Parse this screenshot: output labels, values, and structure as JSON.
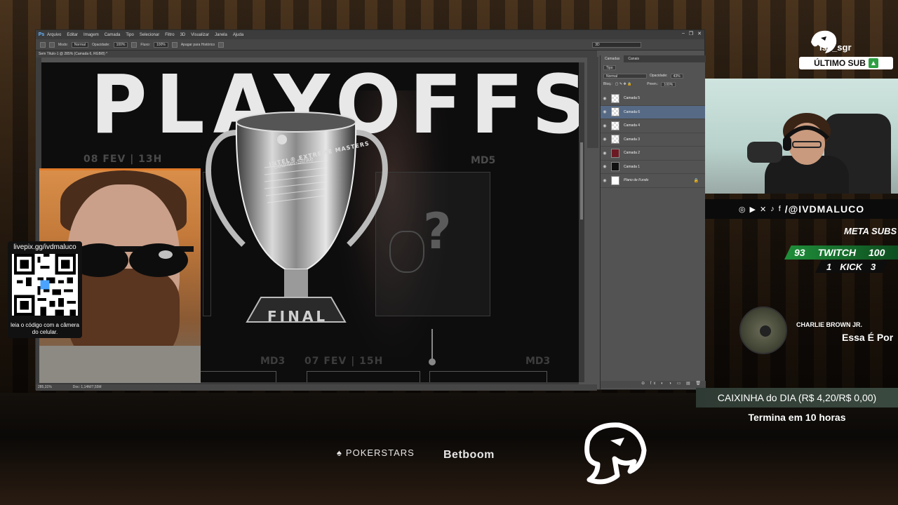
{
  "photoshop": {
    "logo": "Ps",
    "menu": [
      "Arquivo",
      "Editar",
      "Imagem",
      "Camada",
      "Tipo",
      "Selecionar",
      "Filtro",
      "3D",
      "Visualizar",
      "Janela",
      "Ajuda"
    ],
    "window_controls": [
      "–",
      "❐",
      "✕"
    ],
    "options": {
      "mode_label": "Modo:",
      "mode_value": "Normal",
      "opacity_label": "Opacidade:",
      "opacity_value": "100%",
      "flow_label": "Fluxo:",
      "flow_value": "100%",
      "history_label": "Apagar para Histórico"
    },
    "workspace": "3D",
    "doc_tab": "Sem Título-1 @ 285% (Camada 6, RGB/8) *",
    "status_zoom": "285,31%",
    "status_doc": "Doc: 1,14M/7,55M",
    "panel": {
      "tabs": [
        "Camadas",
        "Canais"
      ],
      "filter_label": "Tipo",
      "blend_mode": "Normal",
      "opacity_label": "Opacidade:",
      "opacity_value": "43%",
      "lock_label": "Bloq.:",
      "fill_label": "Preen.:",
      "fill_value": "100%",
      "layers": [
        {
          "name": "Camada 5"
        },
        {
          "name": "Camada 6"
        },
        {
          "name": "Camada 4"
        },
        {
          "name": "Camada 3"
        },
        {
          "name": "Camada 2"
        },
        {
          "name": "Camada 1"
        },
        {
          "name": "Plano de Fundo"
        }
      ],
      "bottom_icons": "⊖ fx ◐ ◑ ▭ ▤ 🗑"
    },
    "artwork": {
      "title": "PLAYOFFS",
      "date_left": "08 FEV | 13H",
      "md5": "MD5",
      "md3_left": "MD3",
      "date_bottom": "07 FEV | 15H",
      "md3_right": "MD3",
      "question": "?",
      "trophy_brand": "INTEL® EXTREME MASTERS",
      "trophy_game": "Counter-Strike",
      "trophy_final": "FINAL"
    }
  },
  "qr": {
    "url": "livepix.gg/ivdmaluco",
    "caption": "leia o código com a câmera do celular."
  },
  "social": {
    "handle": "/@IVDMALUCO",
    "icons": [
      "instagram-icon",
      "youtube-icon",
      "x-icon",
      "tiktok-icon",
      "facebook-icon"
    ]
  },
  "sub_goals": {
    "title": "META SUBS",
    "twitch": {
      "current": "93",
      "label": "TWITCH",
      "goal": "100"
    },
    "kick": {
      "current": "1",
      "label": "KICK",
      "goal": "3"
    }
  },
  "music": {
    "artist": "CHARLIE BROWN JR.",
    "song": "Essa É Por"
  },
  "last_sub": {
    "username": "isa_sgr",
    "label": "ÚLTIMO SUB"
  },
  "caixinha": {
    "label": "CAIXINHA do DIA (R$ 4,20/R$ 0,00)",
    "time": "Termina em 10 horas"
  },
  "sponsors": {
    "pokerstars": "POKERSTARS",
    "betboom": "Betboom"
  }
}
